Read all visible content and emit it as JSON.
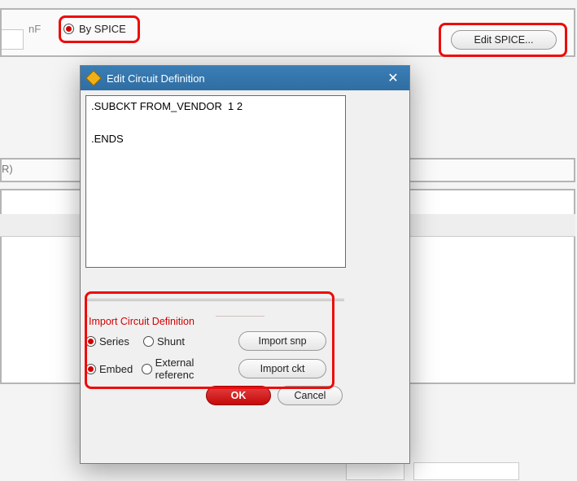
{
  "bg": {
    "nf_label": "nF",
    "by_spice_label": "By SPICE",
    "edit_spice_label": "Edit SPICE...",
    "strip2_label": "R)"
  },
  "dialog": {
    "title": "Edit Circuit Definition",
    "textarea": ".SUBCKT FROM_VENDOR  1 2\n\n.ENDS",
    "fieldset_label": "Import Circuit Definition",
    "radios": {
      "series": "Series",
      "shunt": "Shunt",
      "embed": "Embed",
      "external": "External referenc"
    },
    "buttons": {
      "import_snp": "Import snp",
      "import_ckt": "Import ckt",
      "ok": "OK",
      "cancel": "Cancel"
    }
  }
}
